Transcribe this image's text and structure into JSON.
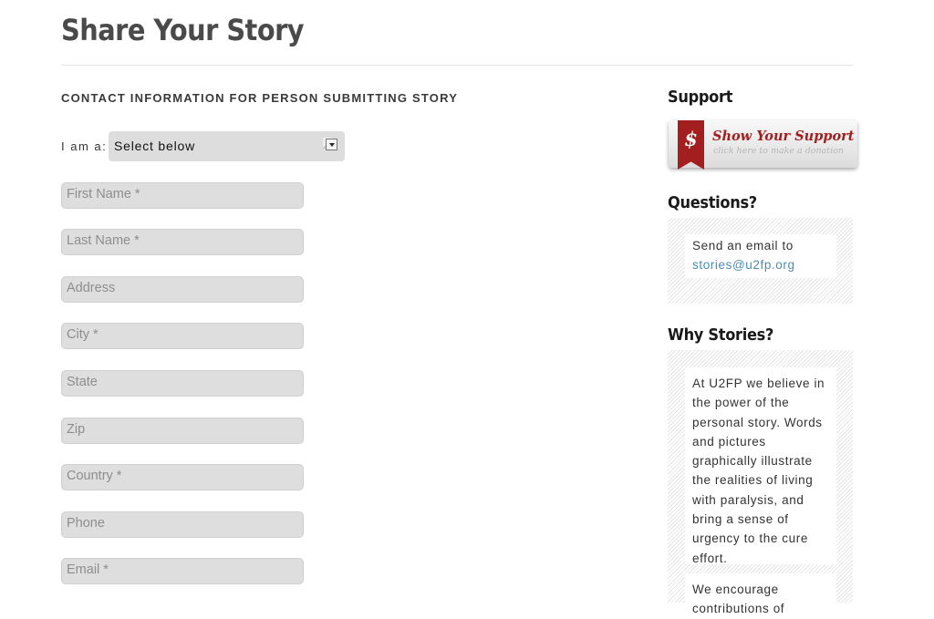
{
  "page": {
    "title": "Share Your Story"
  },
  "form": {
    "section_heading": "CONTACT INFORMATION FOR PERSON SUBMITTING STORY",
    "role_label": "I am a:",
    "role_select_value": "Select below",
    "fields": [
      {
        "placeholder": "First Name *"
      },
      {
        "placeholder": "Last Name *"
      },
      {
        "placeholder": "Address"
      },
      {
        "placeholder": "City *"
      },
      {
        "placeholder": "State"
      },
      {
        "placeholder": "Zip"
      },
      {
        "placeholder": "Country *"
      },
      {
        "placeholder": "Phone"
      },
      {
        "placeholder": "Email *"
      }
    ]
  },
  "sidebar": {
    "support": {
      "heading": "Support",
      "button_symbol": "$",
      "button_title": "Show Your Support",
      "button_subtitle": "click here to make a donation",
      "accent_color": "#a31f1f"
    },
    "questions": {
      "heading": "Questions?",
      "text": "Send an email to",
      "email": "stories@u2fp.org",
      "link_color": "#4b8db3"
    },
    "why_stories": {
      "heading": "Why Stories?",
      "paragraph1": "At U2FP we believe in the power of the personal story. Words and pictures graphically illustrate the realities of living with paralysis, and bring a sense of urgency to the cure effort.",
      "paragraph2": "We encourage contributions of"
    }
  }
}
